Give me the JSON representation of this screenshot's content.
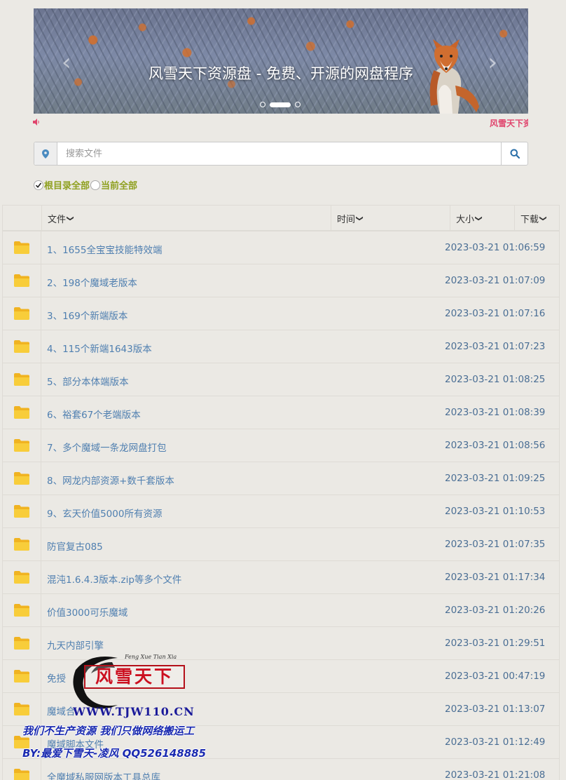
{
  "carousel": {
    "caption": "风雪天下资源盘 - 免费、开源的网盘程序",
    "prev_glyph": "‹",
    "next_glyph": "›",
    "slide_count": 3,
    "active_slide": 2
  },
  "notice": {
    "text": "风雪天下资",
    "color": "#e0456d"
  },
  "search": {
    "placeholder": "搜索文件"
  },
  "scope": {
    "options": [
      {
        "label": "根目录全部",
        "checked": true
      },
      {
        "label": "当前全部",
        "checked": false
      }
    ]
  },
  "table": {
    "headers": {
      "file": "文件",
      "time": "时间",
      "size": "大小",
      "download": "下载"
    },
    "rows": [
      {
        "name": "1、1655全宝宝技能特效端",
        "time": "2023-03-21 01:06:59"
      },
      {
        "name": "2、198个魔域老版本",
        "time": "2023-03-21 01:07:09"
      },
      {
        "name": "3、169个新端版本",
        "time": "2023-03-21 01:07:16"
      },
      {
        "name": "4、115个新端1643版本",
        "time": "2023-03-21 01:07:23"
      },
      {
        "name": "5、部分本体端版本",
        "time": "2023-03-21 01:08:25"
      },
      {
        "name": "6、裕套67个老端版本",
        "time": "2023-03-21 01:08:39"
      },
      {
        "name": "7、多个魔域一条龙网盘打包",
        "time": "2023-03-21 01:08:56"
      },
      {
        "name": "8、网龙内部资源+数千套版本",
        "time": "2023-03-21 01:09:25"
      },
      {
        "name": "9、玄天价值5000所有资源",
        "time": "2023-03-21 01:10:53"
      },
      {
        "name": "防官复古085",
        "time": "2023-03-21 01:07:35"
      },
      {
        "name": "混沌1.6.4.3版本.zip等多个文件",
        "time": "2023-03-21 01:17:34"
      },
      {
        "name": "价值3000可乐魔域",
        "time": "2023-03-21 01:20:26"
      },
      {
        "name": "九天内部引擎",
        "time": "2023-03-21 01:29:51"
      },
      {
        "name": "免授",
        "time": "2023-03-21 00:47:19"
      },
      {
        "name": "魔域合",
        "time": "2023-03-21 01:13:07"
      },
      {
        "name": "魔域脚本文件",
        "time": "2023-03-21 01:12:49"
      },
      {
        "name": "全魔域私服网版本工具总库",
        "time": "2023-03-21 01:21:08"
      }
    ]
  },
  "watermark": {
    "pinyin": "Feng Xue Tian Xia",
    "stamp": "风雪天下",
    "url": "WWW.TJW110.CN",
    "line1": "我们不生产资源  我们只做网络搬运工",
    "line2": "BY:最爱下雪天-凌风 QQ526148885"
  },
  "colors": {
    "link": "#4f7fb0",
    "time": "#4a6e94",
    "scope_label": "#8fa020",
    "folder": "#f6c328"
  }
}
